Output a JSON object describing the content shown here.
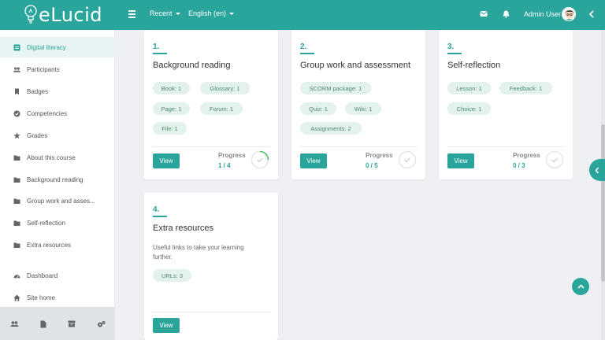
{
  "brand": {
    "logo_text": "eLucid"
  },
  "navbar": {
    "recent_label": "Recent",
    "language_label": "English (en)",
    "user_name": "Admin User",
    "accent_color": "#2aa59b"
  },
  "sidebar": {
    "items": [
      {
        "label": "Digital literacy",
        "icon": "course-icon",
        "active": true
      },
      {
        "label": "Participants",
        "icon": "users-icon"
      },
      {
        "label": "Badges",
        "icon": "bookmark-icon"
      },
      {
        "label": "Competencies",
        "icon": "check-circle-icon"
      },
      {
        "label": "Grades",
        "icon": "star-icon"
      },
      {
        "label": "About this course",
        "icon": "folder-icon"
      },
      {
        "label": "Background reading",
        "icon": "folder-icon"
      },
      {
        "label": "Group work and asses...",
        "icon": "folder-icon"
      },
      {
        "label": "Self-reflection",
        "icon": "folder-icon"
      },
      {
        "label": "Extra resources",
        "icon": "folder-icon"
      },
      {
        "label": "Dashboard",
        "icon": "dashboard-icon"
      },
      {
        "label": "Site home",
        "icon": "home-icon"
      }
    ],
    "footer_icons": [
      "users-icon",
      "file-icon",
      "archive-icon",
      "cogs-icon"
    ]
  },
  "sections": [
    {
      "number": "1.",
      "title": "Background reading",
      "activities": [
        "Book: 1",
        "Glossary: 1",
        "Page: 1",
        "Forum: 1",
        "File: 1"
      ],
      "button": "View",
      "progress_label": "Progress",
      "progress_value": "1 / 4",
      "progress_fraction": 0.25
    },
    {
      "number": "2.",
      "title": "Group work and assessment",
      "activities": [
        "SCORM package: 1",
        "Quiz: 1",
        "Wiki: 1",
        "Assignments: 2"
      ],
      "button": "View",
      "progress_label": "Progress",
      "progress_value": "0 / 5",
      "progress_fraction": 0
    },
    {
      "number": "3.",
      "title": "Self-reflection",
      "activities": [
        "Lesson: 1",
        "Feedback: 1",
        "Choice: 1"
      ],
      "button": "View",
      "progress_label": "Progress",
      "progress_value": "0 / 3",
      "progress_fraction": 0
    },
    {
      "number": "4.",
      "title": "Extra resources",
      "description": "Useful links to take your learning further.",
      "activities": [
        "URLs: 3"
      ],
      "button": "View"
    }
  ]
}
